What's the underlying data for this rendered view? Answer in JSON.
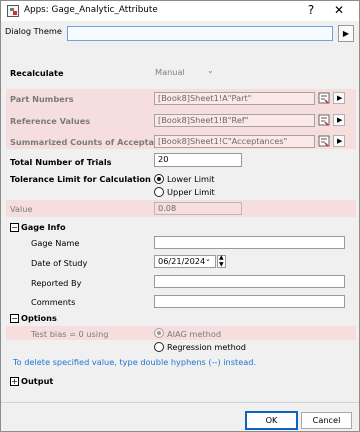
{
  "window": {
    "title": "Apps: Gage_Analytic_Attribute",
    "help_icon": "help-icon",
    "close_icon": "close-icon"
  },
  "dialog_theme": {
    "label": "Dialog Theme",
    "value": "",
    "arrow": "▶"
  },
  "recalculate": {
    "label": "Recalculate",
    "value": "Manual"
  },
  "inputs": {
    "part_numbers": {
      "label": "Part Numbers",
      "value": "[Book8]Sheet1!A\"Part\""
    },
    "reference_values": {
      "label": "Reference Values",
      "value": "[Book8]Sheet1!B\"Ref\""
    },
    "summarized_counts": {
      "label": "Summarized Counts of Acceptances",
      "value": "[Book8]Sheet1!C\"Acceptances\""
    }
  },
  "trials": {
    "label": "Total Number of Trials",
    "value": "20"
  },
  "tolerance": {
    "label": "Tolerance Limit for Calculation",
    "options": [
      "Lower Limit",
      "Upper Limit"
    ],
    "selected": "Lower Limit"
  },
  "value_row": {
    "label": "Value",
    "value": "0.08"
  },
  "gage_info": {
    "label": "Gage Info",
    "expanded_symbol": "−",
    "fields": {
      "gage_name": {
        "label": "Gage Name",
        "value": ""
      },
      "date_of_study": {
        "label": "Date of Study",
        "value": "06/21/2024"
      },
      "reported_by": {
        "label": "Reported By",
        "value": ""
      },
      "comments": {
        "label": "Comments",
        "value": ""
      }
    }
  },
  "options": {
    "label": "Options",
    "expanded_symbol": "−",
    "test_bias": {
      "label": "Test bias = 0 using",
      "choices": [
        "AIAG method",
        "Regression method"
      ],
      "selected": "AIAG method"
    }
  },
  "note": "To delete specified value, type double hyphens (--) instead.",
  "output": {
    "label": "Output",
    "collapsed_symbol": "+"
  },
  "buttons": {
    "ok": "OK",
    "cancel": "Cancel"
  }
}
